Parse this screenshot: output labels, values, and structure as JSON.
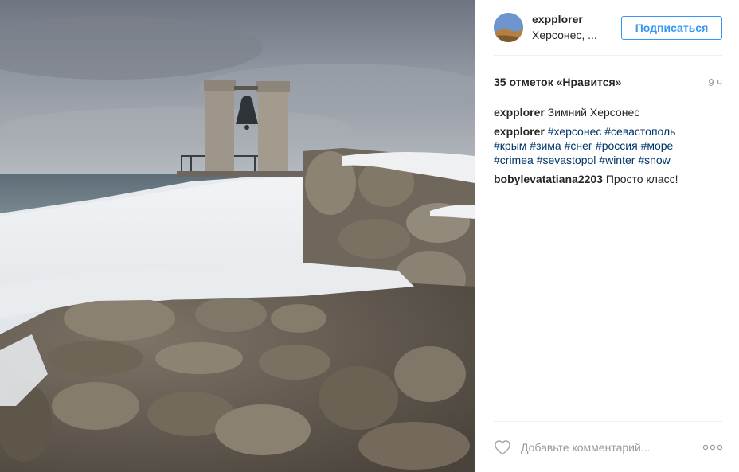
{
  "post": {
    "username": "expplorer",
    "location": "Херсонес, ...",
    "follow_label": "Подписаться",
    "likes": "35 отметок «Нравится»",
    "time": "9 ч"
  },
  "caption": {
    "author": "expplorer",
    "text": "Зимний Херсонес"
  },
  "hashtags_comment": {
    "author": "expplorer",
    "tags": [
      "#херсонес",
      "#севастополь",
      "#крым",
      "#зима",
      "#снег",
      "#россия",
      "#море",
      "#crimea",
      "#sevastopol",
      "#winter",
      "#snow"
    ]
  },
  "comment2": {
    "author": "bobylevatatiana2203",
    "text": "Просто класс!"
  },
  "footer": {
    "comment_placeholder": "Добавьте комментарий..."
  },
  "icons": {
    "heart": "heart-icon",
    "more": "more-icon"
  },
  "colors": {
    "accent": "#3897f0",
    "hashtag": "#003569",
    "muted": "#999999"
  }
}
